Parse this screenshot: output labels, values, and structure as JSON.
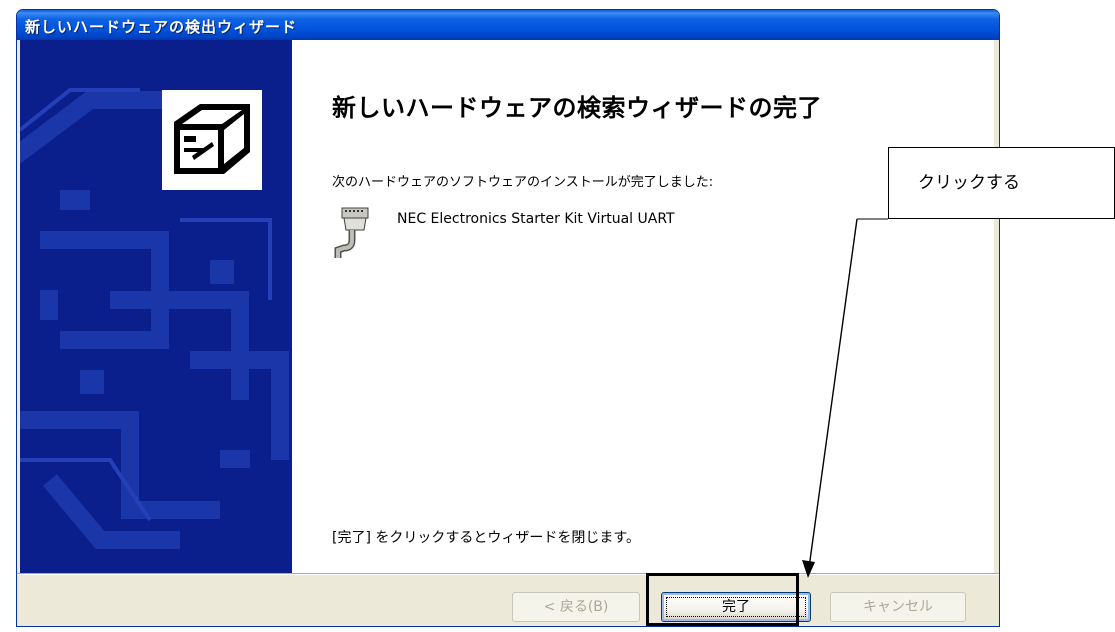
{
  "window": {
    "title": "新しいハードウェアの検出ウィザード"
  },
  "content": {
    "heading": "新しいハードウェアの検索ウィザードの完了",
    "message": "次のハードウェアのソフトウェアのインストールが完了しました:",
    "device_name": "NEC Electronics Starter Kit Virtual UART",
    "close_message": "[完了] をクリックするとウィザードを閉じます。"
  },
  "buttons": {
    "back": "< 戻る(B)",
    "finish": "完了",
    "cancel": "キャンセル"
  },
  "annotation": {
    "callout_text": "クリックする"
  },
  "icons": {
    "wizard_graphic": "hardware-wizard-icon",
    "device": "serial-port-connector-icon"
  },
  "colors": {
    "titlebar": "#0050d8",
    "sidepane": "#0b1f8c",
    "dialog_bg": "#ece9d8"
  }
}
